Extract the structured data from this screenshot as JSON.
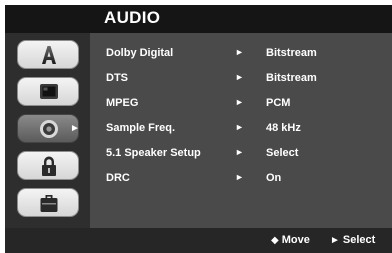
{
  "title": "AUDIO",
  "tabs": [
    {
      "name": "language",
      "icon": "letter-a-icon",
      "selected": false
    },
    {
      "name": "display",
      "icon": "tv-monitor-icon",
      "selected": false
    },
    {
      "name": "audio",
      "icon": "speaker-icon",
      "selected": true
    },
    {
      "name": "lock",
      "icon": "padlock-icon",
      "selected": false
    },
    {
      "name": "others",
      "icon": "briefcase-icon",
      "selected": false
    }
  ],
  "settings": [
    {
      "label": "Dolby Digital",
      "value": "Bitstream"
    },
    {
      "label": "DTS",
      "value": "Bitstream"
    },
    {
      "label": "MPEG",
      "value": "PCM"
    },
    {
      "label": "Sample Freq.",
      "value": "48 kHz"
    },
    {
      "label": "5.1 Speaker Setup",
      "value": "Select"
    },
    {
      "label": "DRC",
      "value": "On"
    }
  ],
  "row_arrow": "►",
  "footer": {
    "move_symbol": "◆",
    "move_label": "Move",
    "select_symbol": "►",
    "select_label": "Select"
  },
  "colors": {
    "title_bar": "#151515",
    "screen_bg": "#2e2e2e",
    "panel_bg": "#4a4a4a",
    "footer_bg": "#262626",
    "text": "#ffffff"
  }
}
